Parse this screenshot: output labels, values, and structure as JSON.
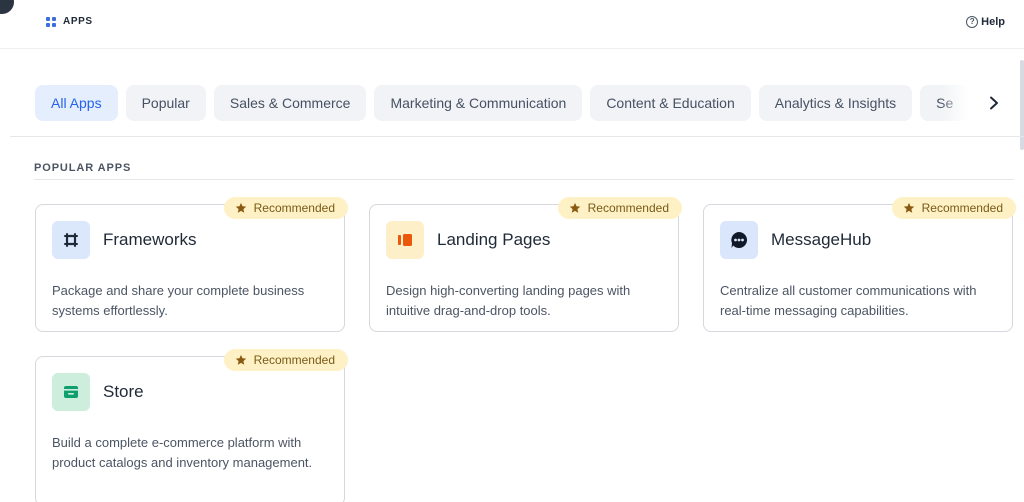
{
  "header": {
    "title": "APPS",
    "help_label": "Help"
  },
  "tabs": [
    {
      "label": "All Apps",
      "active": true
    },
    {
      "label": "Popular",
      "active": false
    },
    {
      "label": "Sales & Commerce",
      "active": false
    },
    {
      "label": "Marketing & Communication",
      "active": false
    },
    {
      "label": "Content & Education",
      "active": false
    },
    {
      "label": "Analytics & Insights",
      "active": false
    },
    {
      "label": "Se",
      "active": false
    }
  ],
  "section": {
    "title": "POPULAR APPS"
  },
  "apps": [
    {
      "name": "Frameworks",
      "badge": "Recommended",
      "description": "Package and share your complete business systems effortlessly.",
      "icon": "frameworks-icon",
      "icon_bg": "#dbe7fb",
      "icon_color": "#1f2937"
    },
    {
      "name": "Landing Pages",
      "badge": "Recommended",
      "description": "Design high-converting landing pages with intuitive drag-and-drop tools.",
      "icon": "landing-pages-icon",
      "icon_bg": "#fdefc8",
      "icon_color": "#ea580c"
    },
    {
      "name": "MessageHub",
      "badge": "Recommended",
      "description": "Centralize all customer communications with real-time messaging capabilities.",
      "icon": "message-hub-icon",
      "icon_bg": "#d9e6fb",
      "icon_color": "#111827"
    },
    {
      "name": "Store",
      "badge": "Recommended",
      "description": "Build a complete e-commerce platform with product catalogs and inventory management.",
      "icon": "store-icon",
      "icon_bg": "#cdeedd",
      "icon_color": "#0f9f6e"
    }
  ],
  "colors": {
    "accent": "#2563eb",
    "badge_bg": "#fdf1c5",
    "star": "#8a5a12"
  }
}
